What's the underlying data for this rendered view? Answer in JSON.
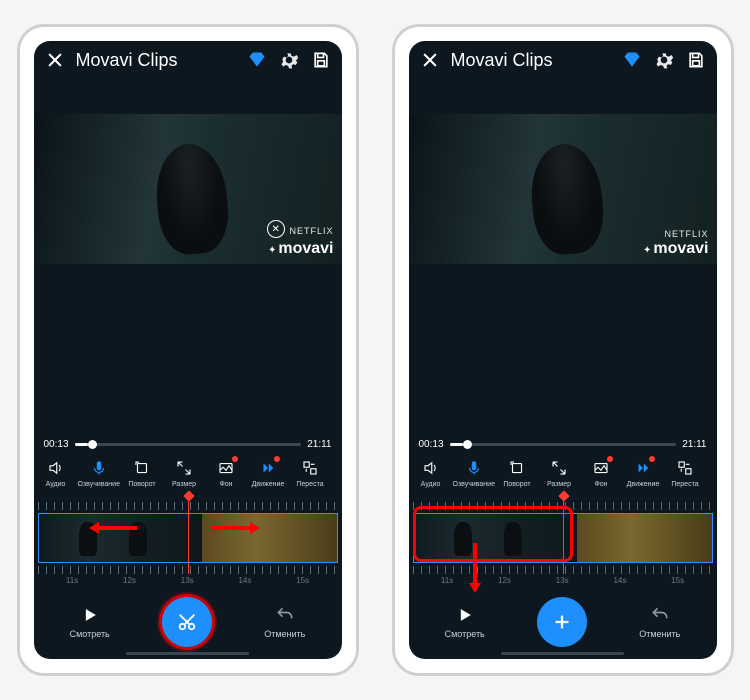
{
  "app_title": "Movavi Clips",
  "time": {
    "current": "00:13",
    "total": "21:11"
  },
  "tools": {
    "audio": "Аудио",
    "voice": "Озвучивание",
    "rotate": "Поворот",
    "size": "Размер",
    "bg": "Фон",
    "motion": "Движение",
    "rearrange": "Переста"
  },
  "timeline_marks": [
    "11s",
    "12s",
    "13s",
    "14s",
    "15s"
  ],
  "bottom": {
    "play": "Смотреть",
    "undo": "Отменить"
  },
  "watermark": {
    "brand_small": "NETFLIX",
    "brand_main": "movavi"
  },
  "colors": {
    "accent": "#1d8fff",
    "annotation": "#ff0000",
    "bg": "#0d1720"
  }
}
